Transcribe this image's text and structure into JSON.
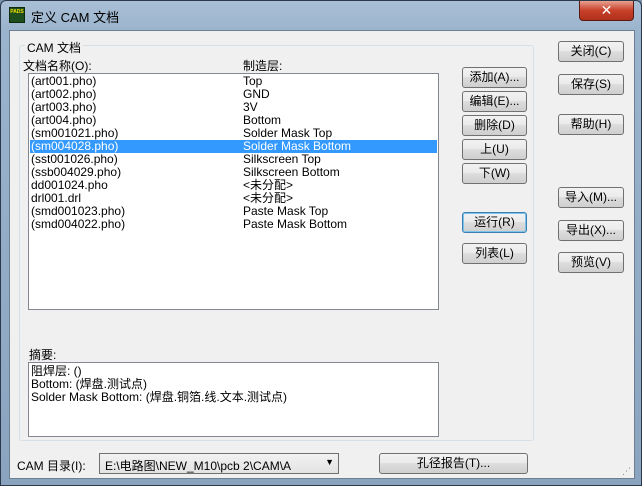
{
  "window": {
    "title": "定义 CAM 文档",
    "icon_text": "PADS",
    "close_glyph": "✕"
  },
  "group": {
    "label": "CAM 文档"
  },
  "list": {
    "col_name_label": "文档名称(O):",
    "col_layer_label": "制造层:",
    "selected_index": 5,
    "rows": [
      {
        "name": "(art001.pho)",
        "layer": "Top"
      },
      {
        "name": "(art002.pho)",
        "layer": "GND"
      },
      {
        "name": "(art003.pho)",
        "layer": "3V"
      },
      {
        "name": "(art004.pho)",
        "layer": "Bottom"
      },
      {
        "name": "(sm001021.pho)",
        "layer": "Solder Mask Top"
      },
      {
        "name": "(sm004028.pho)",
        "layer": "Solder Mask Bottom"
      },
      {
        "name": "(sst001026.pho)",
        "layer": "Silkscreen Top"
      },
      {
        "name": "(ssb004029.pho)",
        "layer": "Silkscreen Bottom"
      },
      {
        "name": "dd001024.pho",
        "layer": "<未分配>"
      },
      {
        "name": "drl001.drl",
        "layer": "<未分配>"
      },
      {
        "name": "(smd001023.pho)",
        "layer": "Paste Mask Top"
      },
      {
        "name": "(smd004022.pho)",
        "layer": "Paste Mask Bottom"
      }
    ]
  },
  "summary": {
    "label": "摘要:",
    "lines": [
      "阻焊层: ()",
      "Bottom: (焊盘.测试点)",
      "Solder Mask Bottom: (焊盘.铜箔.线.文本.测试点)"
    ]
  },
  "buttons": {
    "add": "添加(A)...",
    "edit": "编辑(E)...",
    "delete": "删除(D)",
    "up": "上(U)",
    "down": "下(W)",
    "run": "运行(R)",
    "list": "列表(L)",
    "close": "关闭(C)",
    "save": "保存(S)",
    "help": "帮助(H)",
    "import": "导入(M)...",
    "export": "导出(X)...",
    "preview": "预览(V)",
    "drill_report": "孔径报告(T)..."
  },
  "cam_dir": {
    "label": "CAM 目录(I):",
    "value": "E:\\电路图\\NEW_M10\\pcb 2\\CAM\\A",
    "arrow": "▼"
  }
}
